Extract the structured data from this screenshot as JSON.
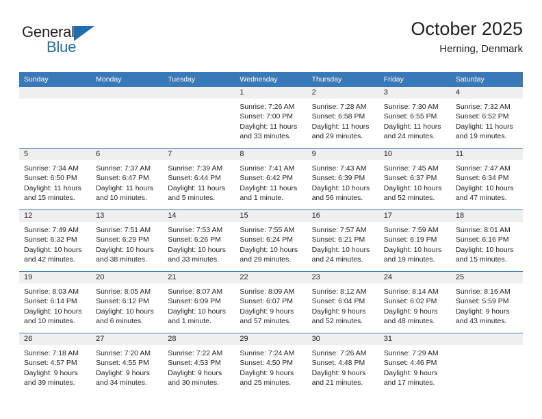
{
  "brand": {
    "name_top": "General",
    "name_bottom": "Blue",
    "accent_color": "#1f6cb0"
  },
  "header": {
    "title": "October 2025",
    "subtitle": "Herning, Denmark"
  },
  "theme": {
    "header_row_color": "#3a79b8",
    "daynum_band_color": "#efefef",
    "text_color": "#231f20"
  },
  "weekday_headers": [
    "Sunday",
    "Monday",
    "Tuesday",
    "Wednesday",
    "Thursday",
    "Friday",
    "Saturday"
  ],
  "weeks": [
    [
      {
        "day": "",
        "lines": []
      },
      {
        "day": "",
        "lines": []
      },
      {
        "day": "",
        "lines": []
      },
      {
        "day": "1",
        "lines": [
          "Sunrise: 7:26 AM",
          "Sunset: 7:00 PM",
          "Daylight: 11 hours",
          "and 33 minutes."
        ]
      },
      {
        "day": "2",
        "lines": [
          "Sunrise: 7:28 AM",
          "Sunset: 6:58 PM",
          "Daylight: 11 hours",
          "and 29 minutes."
        ]
      },
      {
        "day": "3",
        "lines": [
          "Sunrise: 7:30 AM",
          "Sunset: 6:55 PM",
          "Daylight: 11 hours",
          "and 24 minutes."
        ]
      },
      {
        "day": "4",
        "lines": [
          "Sunrise: 7:32 AM",
          "Sunset: 6:52 PM",
          "Daylight: 11 hours",
          "and 19 minutes."
        ]
      }
    ],
    [
      {
        "day": "5",
        "lines": [
          "Sunrise: 7:34 AM",
          "Sunset: 6:50 PM",
          "Daylight: 11 hours",
          "and 15 minutes."
        ]
      },
      {
        "day": "6",
        "lines": [
          "Sunrise: 7:37 AM",
          "Sunset: 6:47 PM",
          "Daylight: 11 hours",
          "and 10 minutes."
        ]
      },
      {
        "day": "7",
        "lines": [
          "Sunrise: 7:39 AM",
          "Sunset: 6:44 PM",
          "Daylight: 11 hours",
          "and 5 minutes."
        ]
      },
      {
        "day": "8",
        "lines": [
          "Sunrise: 7:41 AM",
          "Sunset: 6:42 PM",
          "Daylight: 11 hours",
          "and 1 minute."
        ]
      },
      {
        "day": "9",
        "lines": [
          "Sunrise: 7:43 AM",
          "Sunset: 6:39 PM",
          "Daylight: 10 hours",
          "and 56 minutes."
        ]
      },
      {
        "day": "10",
        "lines": [
          "Sunrise: 7:45 AM",
          "Sunset: 6:37 PM",
          "Daylight: 10 hours",
          "and 52 minutes."
        ]
      },
      {
        "day": "11",
        "lines": [
          "Sunrise: 7:47 AM",
          "Sunset: 6:34 PM",
          "Daylight: 10 hours",
          "and 47 minutes."
        ]
      }
    ],
    [
      {
        "day": "12",
        "lines": [
          "Sunrise: 7:49 AM",
          "Sunset: 6:32 PM",
          "Daylight: 10 hours",
          "and 42 minutes."
        ]
      },
      {
        "day": "13",
        "lines": [
          "Sunrise: 7:51 AM",
          "Sunset: 6:29 PM",
          "Daylight: 10 hours",
          "and 38 minutes."
        ]
      },
      {
        "day": "14",
        "lines": [
          "Sunrise: 7:53 AM",
          "Sunset: 6:26 PM",
          "Daylight: 10 hours",
          "and 33 minutes."
        ]
      },
      {
        "day": "15",
        "lines": [
          "Sunrise: 7:55 AM",
          "Sunset: 6:24 PM",
          "Daylight: 10 hours",
          "and 29 minutes."
        ]
      },
      {
        "day": "16",
        "lines": [
          "Sunrise: 7:57 AM",
          "Sunset: 6:21 PM",
          "Daylight: 10 hours",
          "and 24 minutes."
        ]
      },
      {
        "day": "17",
        "lines": [
          "Sunrise: 7:59 AM",
          "Sunset: 6:19 PM",
          "Daylight: 10 hours",
          "and 19 minutes."
        ]
      },
      {
        "day": "18",
        "lines": [
          "Sunrise: 8:01 AM",
          "Sunset: 6:16 PM",
          "Daylight: 10 hours",
          "and 15 minutes."
        ]
      }
    ],
    [
      {
        "day": "19",
        "lines": [
          "Sunrise: 8:03 AM",
          "Sunset: 6:14 PM",
          "Daylight: 10 hours",
          "and 10 minutes."
        ]
      },
      {
        "day": "20",
        "lines": [
          "Sunrise: 8:05 AM",
          "Sunset: 6:12 PM",
          "Daylight: 10 hours",
          "and 6 minutes."
        ]
      },
      {
        "day": "21",
        "lines": [
          "Sunrise: 8:07 AM",
          "Sunset: 6:09 PM",
          "Daylight: 10 hours",
          "and 1 minute."
        ]
      },
      {
        "day": "22",
        "lines": [
          "Sunrise: 8:09 AM",
          "Sunset: 6:07 PM",
          "Daylight: 9 hours",
          "and 57 minutes."
        ]
      },
      {
        "day": "23",
        "lines": [
          "Sunrise: 8:12 AM",
          "Sunset: 6:04 PM",
          "Daylight: 9 hours",
          "and 52 minutes."
        ]
      },
      {
        "day": "24",
        "lines": [
          "Sunrise: 8:14 AM",
          "Sunset: 6:02 PM",
          "Daylight: 9 hours",
          "and 48 minutes."
        ]
      },
      {
        "day": "25",
        "lines": [
          "Sunrise: 8:16 AM",
          "Sunset: 5:59 PM",
          "Daylight: 9 hours",
          "and 43 minutes."
        ]
      }
    ],
    [
      {
        "day": "26",
        "lines": [
          "Sunrise: 7:18 AM",
          "Sunset: 4:57 PM",
          "Daylight: 9 hours",
          "and 39 minutes."
        ]
      },
      {
        "day": "27",
        "lines": [
          "Sunrise: 7:20 AM",
          "Sunset: 4:55 PM",
          "Daylight: 9 hours",
          "and 34 minutes."
        ]
      },
      {
        "day": "28",
        "lines": [
          "Sunrise: 7:22 AM",
          "Sunset: 4:53 PM",
          "Daylight: 9 hours",
          "and 30 minutes."
        ]
      },
      {
        "day": "29",
        "lines": [
          "Sunrise: 7:24 AM",
          "Sunset: 4:50 PM",
          "Daylight: 9 hours",
          "and 25 minutes."
        ]
      },
      {
        "day": "30",
        "lines": [
          "Sunrise: 7:26 AM",
          "Sunset: 4:48 PM",
          "Daylight: 9 hours",
          "and 21 minutes."
        ]
      },
      {
        "day": "31",
        "lines": [
          "Sunrise: 7:29 AM",
          "Sunset: 4:46 PM",
          "Daylight: 9 hours",
          "and 17 minutes."
        ]
      },
      {
        "day": "",
        "lines": []
      }
    ]
  ]
}
